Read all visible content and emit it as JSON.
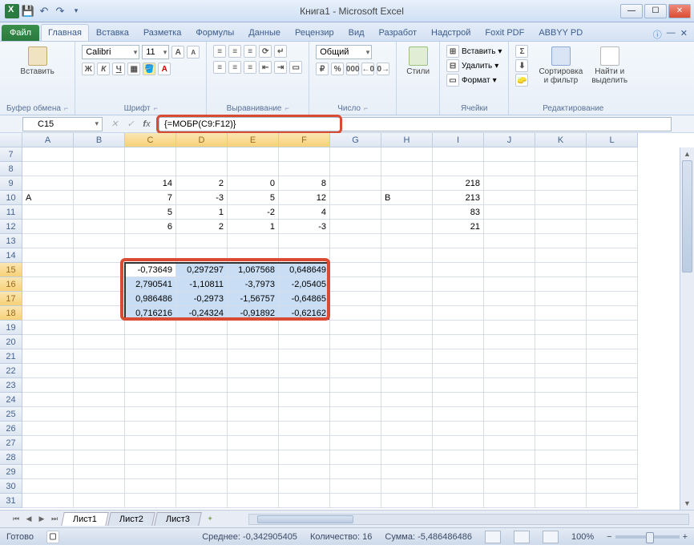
{
  "window": {
    "title": "Книга1 - Microsoft Excel"
  },
  "ribbon": {
    "file": "Файл",
    "tabs": [
      "Главная",
      "Вставка",
      "Разметка",
      "Формулы",
      "Данные",
      "Рецензир",
      "Вид",
      "Разработ",
      "Надстрой",
      "Foxit PDF",
      "ABBYY PD"
    ],
    "active_tab": 0,
    "groups": {
      "clipboard": {
        "paste": "Вставить",
        "label": "Буфер обмена"
      },
      "font": {
        "name": "Calibri",
        "size": "11",
        "label": "Шрифт"
      },
      "alignment": {
        "label": "Выравнивание"
      },
      "number": {
        "format": "Общий",
        "label": "Число"
      },
      "styles": {
        "btn": "Стили",
        "label": ""
      },
      "cells": {
        "insert": "Вставить",
        "delete": "Удалить",
        "format": "Формат",
        "label": "Ячейки"
      },
      "editing": {
        "sort": "Сортировка\nи фильтр",
        "find": "Найти и\nвыделить",
        "label": "Редактирование"
      }
    }
  },
  "namebox": "C15",
  "formula": "{=МОБР(C9:F12)}",
  "columns": [
    "A",
    "B",
    "C",
    "D",
    "E",
    "F",
    "G",
    "H",
    "I",
    "J",
    "K",
    "L"
  ],
  "row_start": 7,
  "row_end": 31,
  "cells": {
    "r9": {
      "C": "14",
      "D": "2",
      "E": "0",
      "F": "8",
      "I": "218"
    },
    "r10": {
      "A": "A",
      "C": "7",
      "D": "-3",
      "E": "5",
      "F": "12",
      "H": "B",
      "I": "213"
    },
    "r11": {
      "C": "5",
      "D": "1",
      "E": "-2",
      "F": "4",
      "I": "83"
    },
    "r12": {
      "C": "6",
      "D": "2",
      "E": "1",
      "F": "-3",
      "I": "21"
    },
    "r15": {
      "C": "-0,73649",
      "D": "0,297297",
      "E": "1,067568",
      "F": "0,648649"
    },
    "r16": {
      "C": "2,790541",
      "D": "-1,10811",
      "E": "-3,7973",
      "F": "-2,05405"
    },
    "r17": {
      "C": "0,986486",
      "D": "-0,2973",
      "E": "-1,56757",
      "F": "-0,64865"
    },
    "r18": {
      "C": "0,716216",
      "D": "-0,24324",
      "E": "-0,91892",
      "F": "-0,62162"
    }
  },
  "selection": {
    "cols": [
      "C",
      "D",
      "E",
      "F"
    ],
    "rows": [
      15,
      16,
      17,
      18
    ],
    "active": "C15"
  },
  "sheets": {
    "list": [
      "Лист1",
      "Лист2",
      "Лист3"
    ],
    "active": 0
  },
  "status": {
    "ready": "Готово",
    "avg_label": "Среднее:",
    "avg": "-0,342905405",
    "count_label": "Количество:",
    "count": "16",
    "sum_label": "Сумма:",
    "sum": "-5,486486486",
    "zoom": "100%"
  }
}
